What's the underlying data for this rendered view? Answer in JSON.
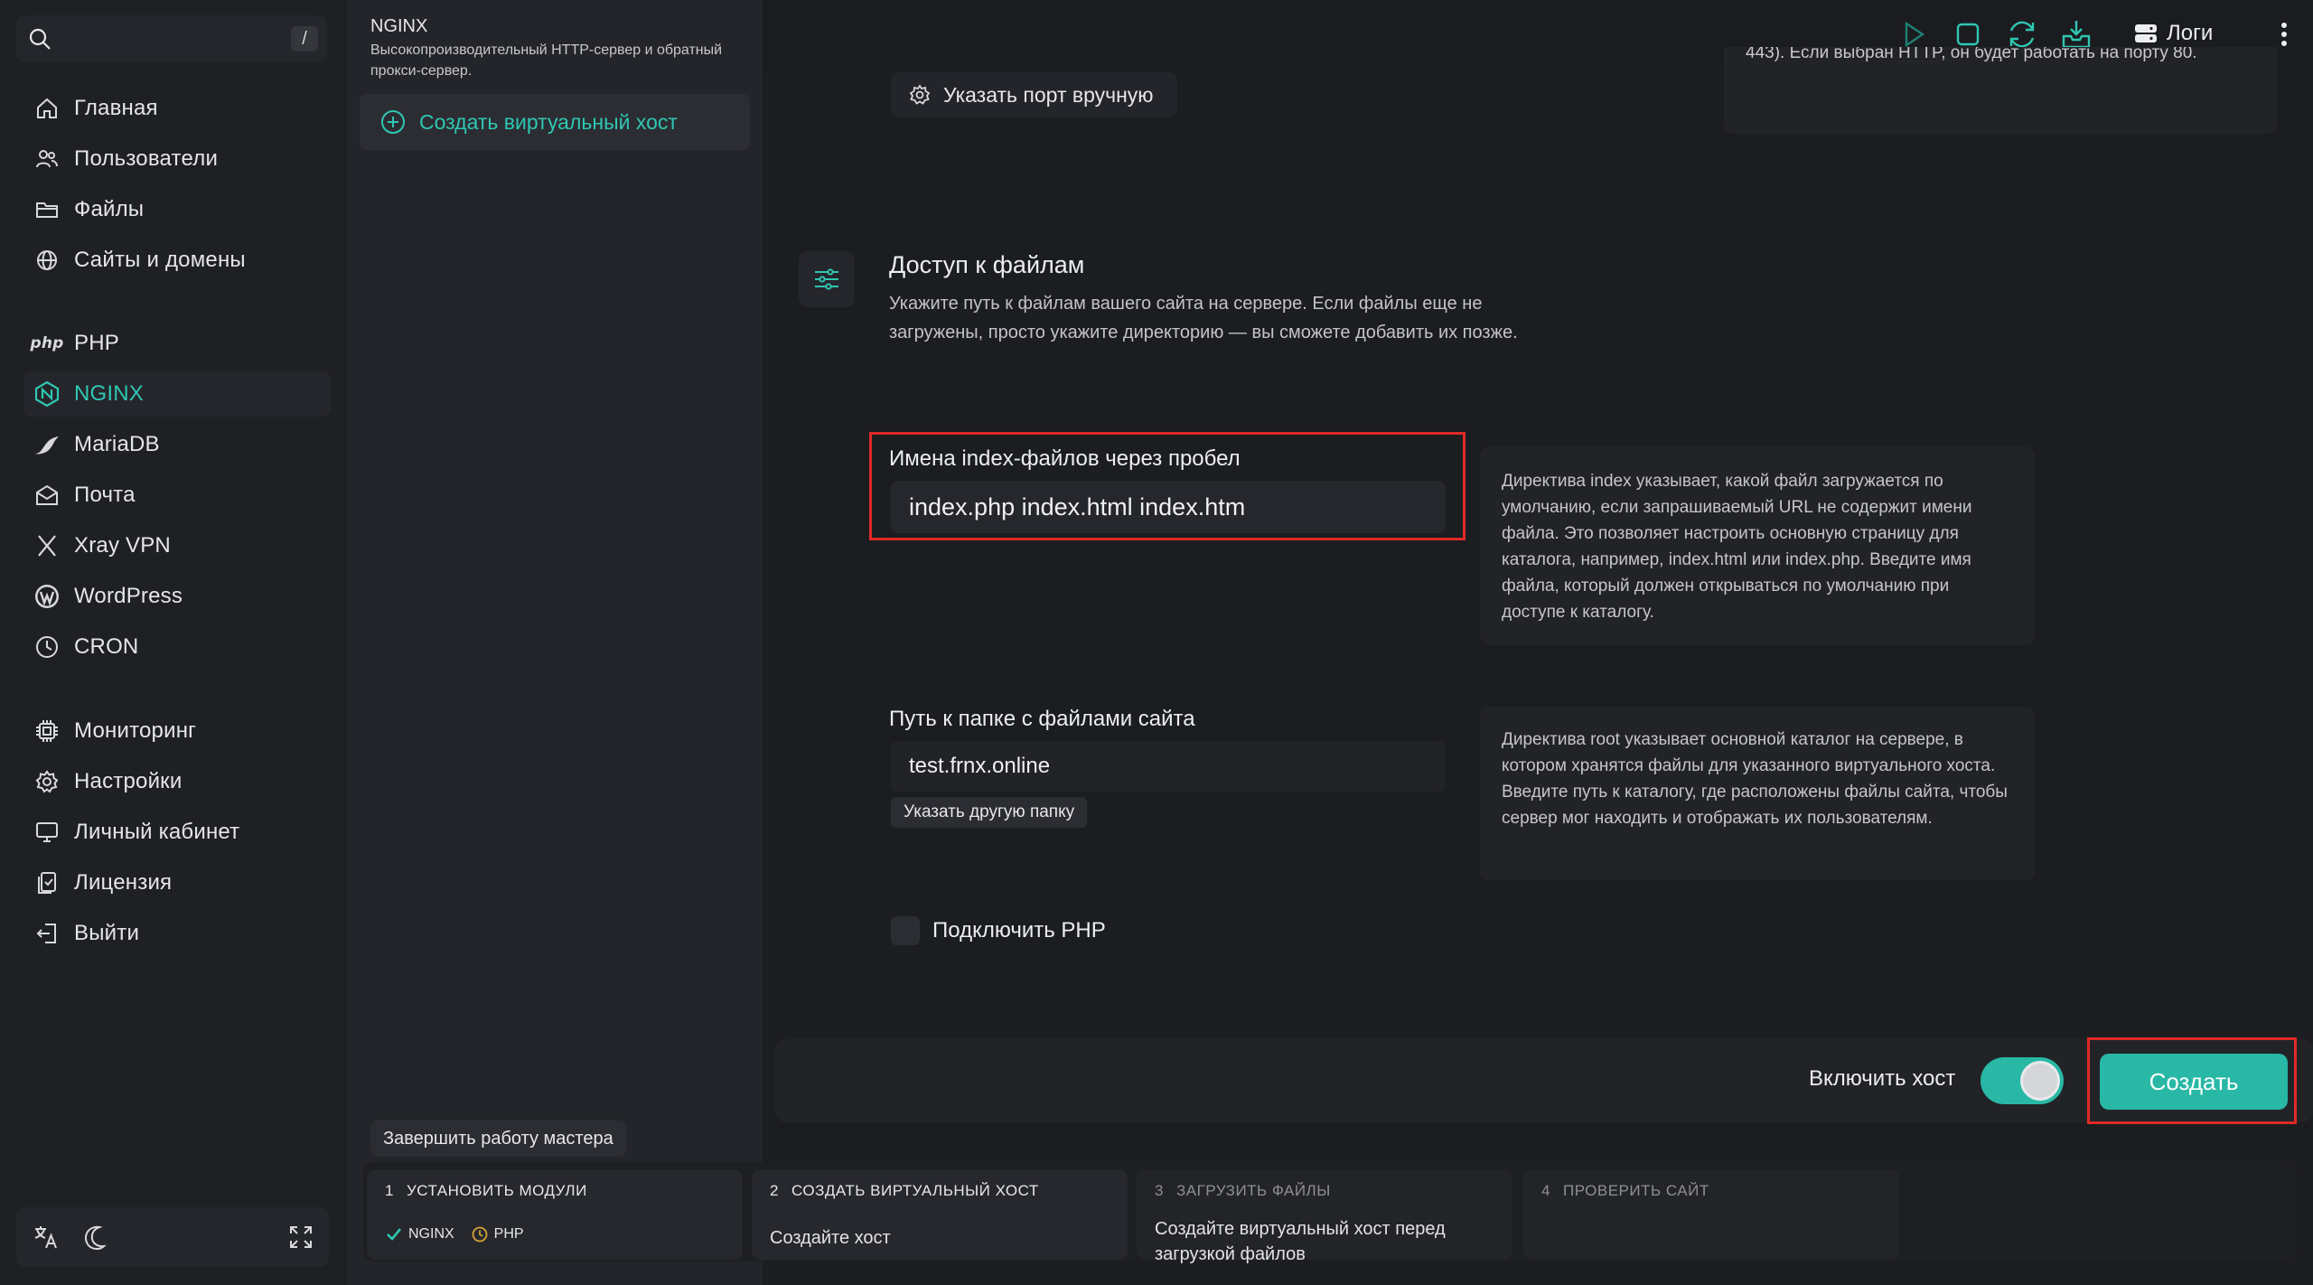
{
  "colors": {
    "accent": "#2fc7b2",
    "highlight": "#e02a26",
    "background": "#1c1d21"
  },
  "search": {
    "shortcut": "/"
  },
  "sidebar": {
    "items": [
      {
        "label": "Главная",
        "icon": "home-icon"
      },
      {
        "label": "Пользователи",
        "icon": "users-icon"
      },
      {
        "label": "Файлы",
        "icon": "folder-icon"
      },
      {
        "label": "Сайты и домены",
        "icon": "globe-icon"
      },
      {
        "label": "PHP",
        "icon": "php-icon"
      },
      {
        "label": "NGINX",
        "icon": "nginx-icon",
        "active": true
      },
      {
        "label": "MariaDB",
        "icon": "mariadb-icon"
      },
      {
        "label": "Почта",
        "icon": "mail-icon"
      },
      {
        "label": "Xray VPN",
        "icon": "xray-icon"
      },
      {
        "label": "WordPress",
        "icon": "wordpress-icon"
      },
      {
        "label": "CRON",
        "icon": "clock-icon"
      },
      {
        "label": "Мониторинг",
        "icon": "cpu-icon"
      },
      {
        "label": "Настройки",
        "icon": "gear-icon"
      },
      {
        "label": "Личный кабинет",
        "icon": "monitor-icon"
      },
      {
        "label": "Лицензия",
        "icon": "license-icon"
      },
      {
        "label": "Выйти",
        "icon": "logout-icon"
      }
    ],
    "php_icon_text": "php"
  },
  "module": {
    "title": "NGINX",
    "description": "Высокопроизводительный HTTP-сервер и обратный прокси-сервер.",
    "create_vhost_label": "Создать виртуальный хост"
  },
  "topbar": {
    "logs_label": "Логи"
  },
  "port": {
    "button_label": "Указать порт вручную",
    "help_text": "443). Если выбран HTTP, он будет работать на порту 80."
  },
  "file_access": {
    "title": "Доступ к файлам",
    "description": "Укажите путь к файлам вашего сайта на сервере. Если файлы еще не загружены, просто укажите директорию — вы сможете добавить их позже.",
    "index_label": "Имена index-файлов через пробел",
    "index_value": "index.php index.html index.htm",
    "index_help": "Директива index указывает, какой файл загружается по умолчанию, если запрашиваемый URL не содержит имени файла. Это позволяет настроить основную страницу для каталога, например, index.html или index.php. Введите имя файла, который должен открываться по умолчанию при доступе к каталогу.",
    "root_label": "Путь к папке с файлами сайта",
    "root_value": "test.frnx.online",
    "pick_folder_label": "Указать другую папку",
    "root_help": "Директива root указывает основной каталог на сервере, в котором хранятся файлы для указанного виртуального хоста. Введите путь к каталогу, где расположены файлы сайта, чтобы сервер мог находить и отображать их пользователям.",
    "php_checkbox_label": "Подключить PHP"
  },
  "actions": {
    "enable_host_label": "Включить хост",
    "create_label": "Создать"
  },
  "wizard": {
    "finish_label": "Завершить работу мастера",
    "steps": [
      {
        "num": "1",
        "title": "УСТАНОВИТЬ МОДУЛИ",
        "tags": [
          "NGINX",
          "PHP"
        ]
      },
      {
        "num": "2",
        "title": "СОЗДАТЬ ВИРТУАЛЬНЫЙ ХОСТ",
        "body": "Создайте хост"
      },
      {
        "num": "3",
        "title": "ЗАГРУЗИТЬ ФАЙЛЫ",
        "body": "Создайте виртуальный хост перед загрузкой файлов"
      },
      {
        "num": "4",
        "title": "ПРОВЕРИТЬ САЙТ"
      }
    ]
  }
}
